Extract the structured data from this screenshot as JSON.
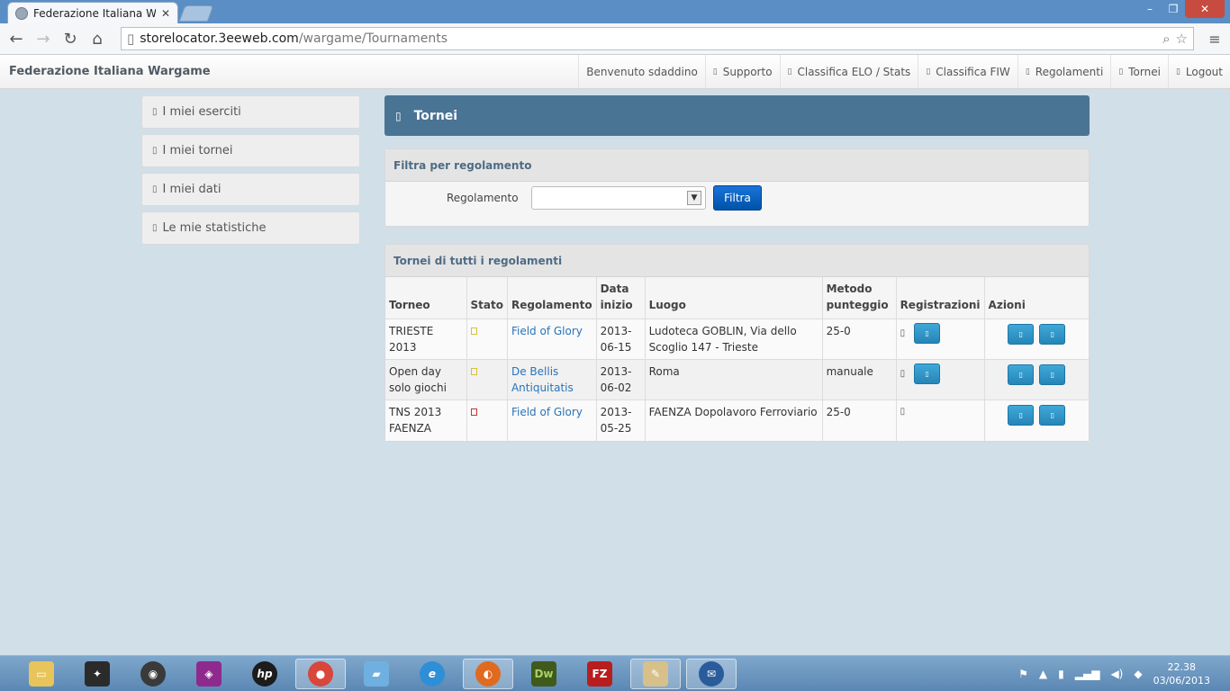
{
  "browser": {
    "tab_title": "Federazione Italiana Warga",
    "url_host": "storelocator.3eeweb.com",
    "url_path": "/wargame/Tournaments"
  },
  "navbar": {
    "brand": "Federazione Italiana Wargame",
    "links": [
      "Benvenuto sdaddino",
      "Supporto",
      "Classifica ELO / Stats",
      "Classifica FIW",
      "Regolamenti",
      "Tornei",
      "Logout"
    ]
  },
  "sidebar": {
    "items": [
      "I miei eserciti",
      "I miei tornei",
      "I miei dati",
      "Le mie statistiche"
    ]
  },
  "page": {
    "title": "Tornei"
  },
  "filter": {
    "heading": "Filtra per regolamento",
    "label": "Regolamento",
    "selected": "",
    "button": "Filtra"
  },
  "tournaments": {
    "heading": "Tornei di tutti i regolamenti",
    "columns": [
      "Torneo",
      "Stato",
      "Regolamento",
      "Data inizio",
      "Luogo",
      "Metodo punteggio",
      "Registrazioni",
      "Azioni"
    ],
    "rows": [
      {
        "torneo": "TRIESTE 2013",
        "regolamento": "Field of Glory",
        "data": "2013-06-15",
        "luogo": "Ludoteca GOBLIN, Via dello Scoglio 147 - Trieste",
        "metodo": "25-0"
      },
      {
        "torneo": "Open day solo giochi",
        "regolamento": "De Bellis Antiquitatis",
        "data": "2013-06-02",
        "luogo": "Roma",
        "metodo": "manuale"
      },
      {
        "torneo": "TNS 2013 FAENZA",
        "regolamento": "Field of Glory",
        "data": "2013-05-25",
        "luogo": "FAENZA Dopolavoro Ferroviario",
        "metodo": "25-0"
      }
    ]
  },
  "taskbar": {
    "time": "22.38",
    "date": "03/06/2013"
  },
  "colors": {
    "header_bg": "#4a7494",
    "primary_button": "#0052a8",
    "info_button": "#2f95c8",
    "link": "#2a73b9"
  }
}
